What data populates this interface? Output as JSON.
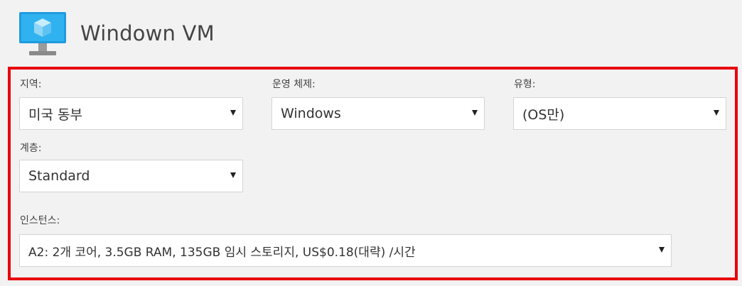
{
  "header": {
    "title": "Windown VM",
    "icon": "virtual-machine-icon"
  },
  "form": {
    "region": {
      "label": "지역:",
      "value": "미국 동부"
    },
    "os": {
      "label": "운영 체제:",
      "value": "Windows"
    },
    "type": {
      "label": "유형:",
      "value": "(OS만)"
    },
    "tier": {
      "label": "계층:",
      "value": "Standard"
    },
    "instance": {
      "label": "인스턴스:",
      "value": "A2: 2개 코어, 3.5GB RAM, 135GB 임시 스토리지, US$0.18(대략) /시간"
    }
  },
  "colors": {
    "highlight": "#e8000b",
    "background": "#f2f2f2",
    "icon_blue": "#1aa0e8"
  }
}
